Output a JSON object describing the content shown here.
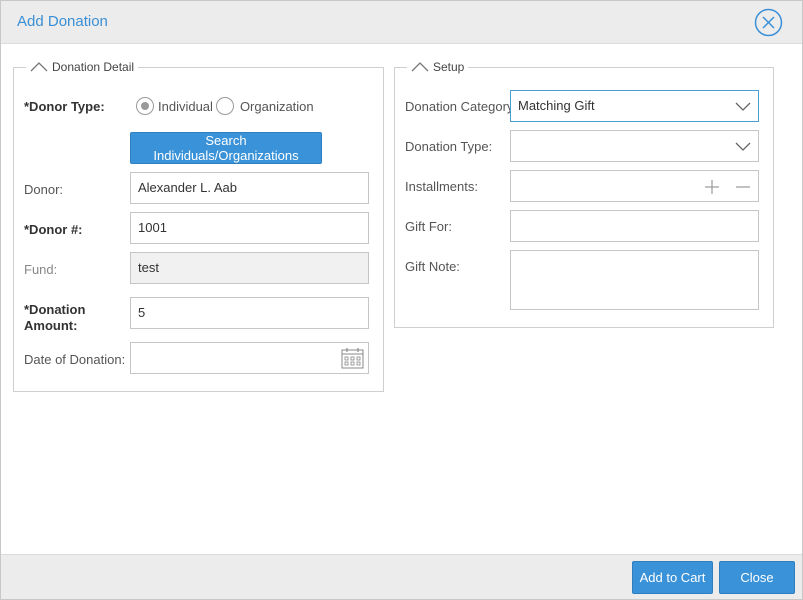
{
  "dialog": {
    "title": "Add Donation"
  },
  "donation_detail": {
    "legend": "Donation Detail",
    "donor_type": {
      "label": "*Donor Type:",
      "options": [
        "Individual",
        "Organization"
      ],
      "selected": "Individual"
    },
    "search_button": "Search Individuals/Organizations",
    "donor": {
      "label": "Donor:",
      "value": "Alexander L. Aab"
    },
    "donor_number": {
      "label": "*Donor #:",
      "value": "1001"
    },
    "fund": {
      "label": "Fund:",
      "value": "test"
    },
    "donation_amount": {
      "label_line1": "*Donation",
      "label_line2": "Amount:",
      "value": "5"
    },
    "date_of_donation": {
      "label": "Date of Donation:",
      "value": ""
    }
  },
  "setup": {
    "legend": "Setup",
    "donation_category": {
      "label": "Donation Category:",
      "value": "Matching Gift"
    },
    "donation_type": {
      "label": "Donation Type:",
      "value": ""
    },
    "installments": {
      "label": "Installments:",
      "value": ""
    },
    "gift_for": {
      "label": "Gift For:",
      "value": ""
    },
    "gift_note": {
      "label": "Gift Note:",
      "value": ""
    }
  },
  "footer": {
    "add_to_cart": "Add to Cart",
    "close": "Close"
  },
  "colors": {
    "accent": "#3a92d8",
    "title": "#3a8fd6",
    "chrome": "#ececec"
  },
  "icons": [
    "close-circle-icon",
    "chevron-up-icon",
    "chevron-down-icon",
    "plus-icon",
    "minus-icon",
    "calendar-icon"
  ]
}
